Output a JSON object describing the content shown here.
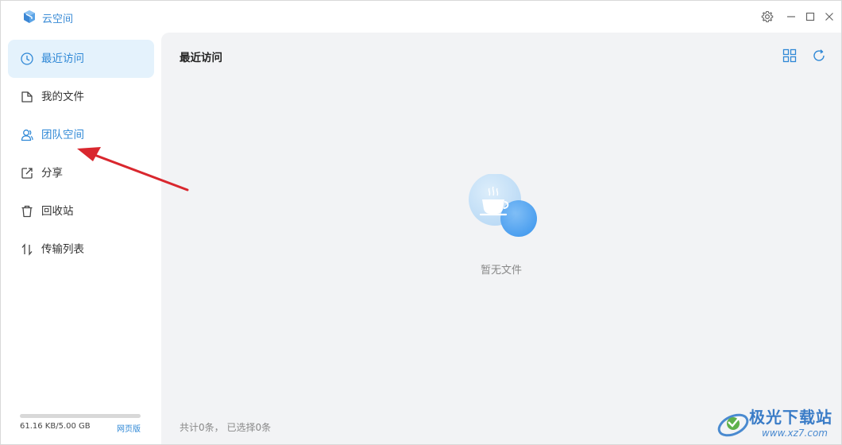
{
  "app": {
    "title": "云空间"
  },
  "sidebar": {
    "items": [
      {
        "id": "recent",
        "label": "最近访问",
        "icon": "clock-icon",
        "active": true
      },
      {
        "id": "myfiles",
        "label": "我的文件",
        "icon": "file-icon",
        "active": false
      },
      {
        "id": "team",
        "label": "团队空间",
        "icon": "team-icon",
        "active": false
      },
      {
        "id": "share",
        "label": "分享",
        "icon": "share-icon",
        "active": false
      },
      {
        "id": "trash",
        "label": "回收站",
        "icon": "trash-icon",
        "active": false
      },
      {
        "id": "transfer",
        "label": "传输列表",
        "icon": "transfer-icon",
        "active": false
      }
    ],
    "storage": {
      "text": "61.16 KB/5.00 GB",
      "used_fraction": 1.19e-05
    },
    "web_version_label": "网页版"
  },
  "main": {
    "title": "最近访问",
    "empty_text": "暂无文件",
    "footer": "共计0条， 已选择0条"
  },
  "watermark": {
    "brand": "极光下载站",
    "url": "www.xz7.com"
  },
  "colors": {
    "accent": "#2f88d6",
    "active_bg": "#e4f2fc",
    "main_bg": "#f2f3f5",
    "arrow": "#d9272e"
  }
}
